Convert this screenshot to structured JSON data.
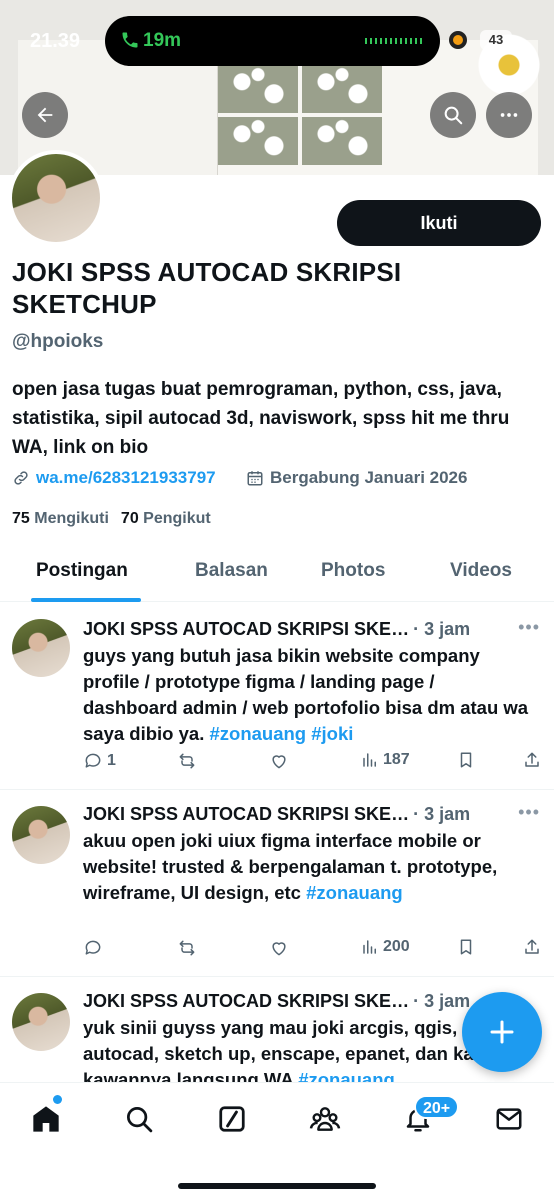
{
  "status_bar": {
    "time": "21.39",
    "call_time": "19m",
    "battery": "43"
  },
  "profile": {
    "display_name": "JOKI SPSS AUTOCAD SKRIPSI SKETCHUP",
    "handle": "@hpoioks",
    "bio": "open jasa tugas buat pemrograman, python, css, java, statistika, sipil autocad 3d, naviswork, spss hit me thru WA, link on bio",
    "link": "wa.me/6283121933797",
    "joined": "Bergabung Januari 2026",
    "following_count": "75",
    "following_label": "Mengikuti",
    "followers_count": "70",
    "followers_label": "Pengikut",
    "follow_button": "Ikuti"
  },
  "tabs": [
    {
      "label": "Postingan",
      "active": true
    },
    {
      "label": "Balasan",
      "active": false
    },
    {
      "label": "Photos",
      "active": false
    },
    {
      "label": "Videos",
      "active": false
    }
  ],
  "posts": [
    {
      "author": "JOKI SPSS AUTOCAD SKRIPSI SKE…",
      "time": "· 3 jam",
      "text": "guys yang butuh jasa bikin website company profile / prototype figma / landing page / dashboard admin / web portofolio bisa dm atau wa saya dibio ya.",
      "tags": " #zonauang #joki",
      "replies": "1",
      "views": "187"
    },
    {
      "author": "JOKI SPSS AUTOCAD SKRIPSI SKE…",
      "time": "· 3 jam",
      "text": "akuu open joki uiux figma interface mobile or website! trusted & berpengalaman  t. prototype, wireframe, UI design, etc",
      "tags": "#zonauang",
      "replies": "",
      "views": "200"
    },
    {
      "author": "JOKI SPSS AUTOCAD SKRIPSI SKE…",
      "time": "· 3 jam",
      "text": "yuk sinii guyss yang mau joki arcgis, qgis, autocad, sketch up, enscape, epanet, dan kawan kawannya langsung WA",
      "tags": " #zonauang",
      "replies": "",
      "views": ""
    }
  ],
  "bottom_nav": {
    "notifications_badge": "20+"
  },
  "colors": {
    "accent": "#1d9bf0",
    "text": "#0f1419",
    "muted": "#536471",
    "call_green": "#34c759"
  }
}
